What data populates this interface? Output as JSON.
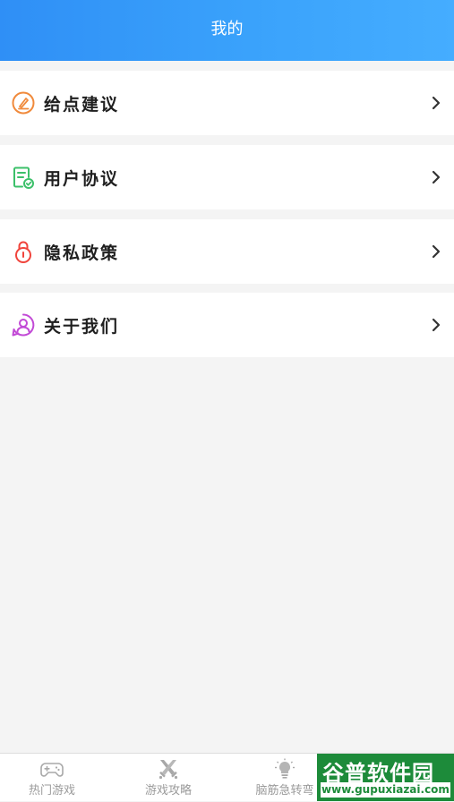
{
  "header": {
    "title": "我的"
  },
  "menu": [
    {
      "label": "给点建议",
      "icon": "edit-icon",
      "color": "#f08a3c"
    },
    {
      "label": "用户协议",
      "icon": "document-check-icon",
      "color": "#3cc06a"
    },
    {
      "label": "隐私政策",
      "icon": "lock-icon",
      "color": "#f0443c"
    },
    {
      "label": "关于我们",
      "icon": "about-user-icon",
      "color": "#c24ad6"
    }
  ],
  "tabbar": {
    "tabs": [
      {
        "label": "热门游戏",
        "icon": "gamepad-icon"
      },
      {
        "label": "游戏攻略",
        "icon": "crossed-swords-icon"
      },
      {
        "label": "脑筋急转弯",
        "icon": "lightbulb-icon"
      }
    ]
  },
  "watermark": {
    "name": "谷普软件园",
    "url": "www.gupuxiazai.com"
  },
  "colors": {
    "header": "#3aa2fb",
    "background": "#f4f4f4",
    "tab_inactive": "#9b9b9b"
  }
}
